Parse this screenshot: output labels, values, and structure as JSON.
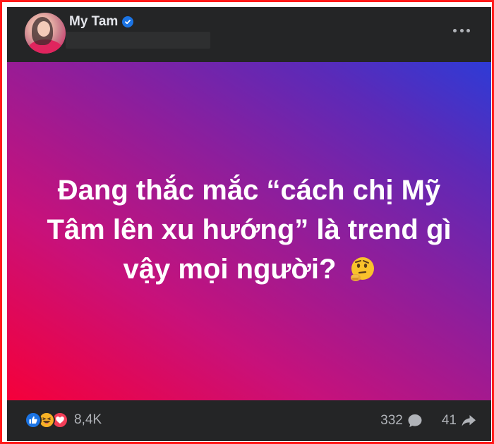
{
  "post": {
    "author": {
      "name": "My Tam",
      "verified_icon": "verified-badge-icon",
      "avatar_icon": "profile-avatar"
    },
    "more_icon": "more-options-icon",
    "message": "Đang thắc mắc “cách chị Mỹ Tâm lên xu hướng” là trend gì vậy mọi người?",
    "message_emoji_icon": "thinking-face-icon",
    "background": {
      "gradient_colors": [
        "#f5003a",
        "#c8117a",
        "#8a1f9e",
        "#5b2ab8",
        "#2e3bd6"
      ]
    }
  },
  "stats": {
    "reactions": [
      "like-icon",
      "haha-icon",
      "love-icon"
    ],
    "reaction_count": "8,4K",
    "comment_count": "332",
    "comment_icon": "comment-bubble-icon",
    "share_count": "41",
    "share_icon": "share-arrow-icon"
  },
  "colors": {
    "border": "#ff1a1a",
    "panel": "#242526",
    "text_primary": "#e4e6eb",
    "text_secondary": "#b0b3b8",
    "verified": "#1b74e4"
  }
}
